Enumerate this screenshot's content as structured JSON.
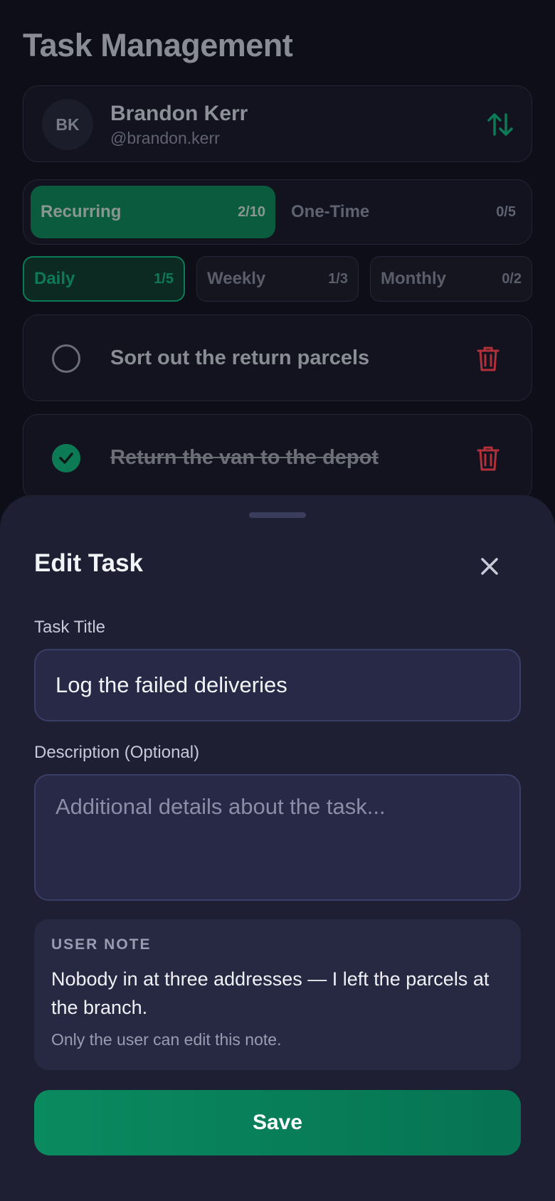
{
  "page": {
    "title": "Task Management"
  },
  "user": {
    "initials": "BK",
    "name": "Brandon Kerr",
    "handle": "@brandon.kerr"
  },
  "segments": [
    {
      "label": "Recurring",
      "count": "2/10",
      "active": true
    },
    {
      "label": "One-Time",
      "count": "0/5",
      "active": false
    }
  ],
  "periods": [
    {
      "label": "Daily",
      "count": "1/5",
      "active": true
    },
    {
      "label": "Weekly",
      "count": "1/3",
      "active": false
    },
    {
      "label": "Monthly",
      "count": "0/2",
      "active": false
    }
  ],
  "tasks": [
    {
      "text": "Sort out the return parcels",
      "done": false
    },
    {
      "text": "Return the van to the depot",
      "done": true
    }
  ],
  "sheet": {
    "title": "Edit Task",
    "task_title_label": "Task Title",
    "task_title_value": "Log the failed deliveries",
    "description_label": "Description (Optional)",
    "description_placeholder": "Additional details about the task...",
    "description_value": "",
    "note": {
      "heading": "USER NOTE",
      "body": "Nobody in at three addresses — I left the parcels at the branch.",
      "footer": "Only the user can edit this note."
    },
    "save_label": "Save"
  },
  "colors": {
    "accent": "#0a8a5f",
    "danger": "#c0392b",
    "sheet_bg": "#1e1f33"
  }
}
